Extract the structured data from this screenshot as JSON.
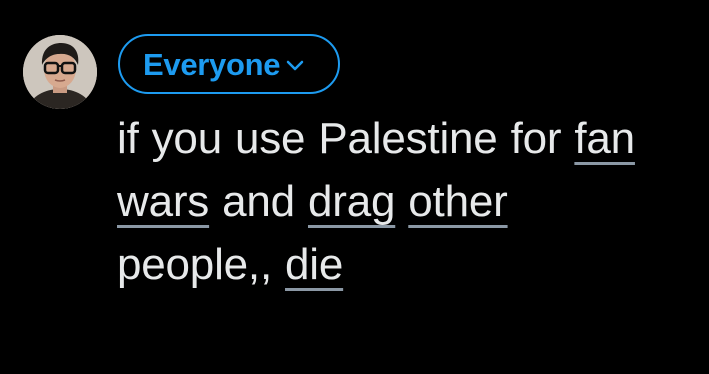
{
  "compose": {
    "audience_label": "Everyone",
    "audience_icon": "chevron-down-icon",
    "accent_color": "#1d9bf0"
  },
  "avatar": {
    "icon": "avatar"
  },
  "text": {
    "line1": {
      "w1": "if you use Palestine for",
      "w2": "fan"
    },
    "line2": {
      "w1": "wars",
      "w2": "and",
      "w3": "drag",
      "w4": "other"
    },
    "line3": {
      "w1": "people,,",
      "w2": "die"
    }
  }
}
